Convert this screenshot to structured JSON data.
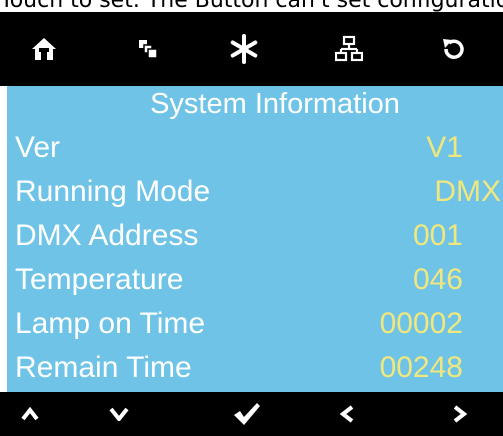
{
  "top_strip_text": "Touch to set. The Button can't set configuration, Long press to Unlock",
  "topbar": {
    "icons": [
      "home-icon",
      "copy-icon",
      "asterisk-icon",
      "network-icon",
      "refresh-icon"
    ]
  },
  "panel": {
    "title": "System Information",
    "rows": [
      {
        "label": "Ver",
        "value": "V1"
      },
      {
        "label": "Running Mode",
        "value": "DMX"
      },
      {
        "label": "DMX Address",
        "value": "001"
      },
      {
        "label": "Temperature",
        "value": "046"
      },
      {
        "label": "Lamp on Time",
        "value": "00002"
      },
      {
        "label": "Remain Time",
        "value": "00248"
      }
    ]
  },
  "bottombar": {
    "icons": [
      "up-icon",
      "down-icon",
      "check-icon",
      "left-icon",
      "right-icon"
    ]
  },
  "colors": {
    "background": "#ffffff",
    "bar": "#000000",
    "panel": "#6ec3e7",
    "label_text": "#ffffff",
    "value_text": "#f1e77f"
  }
}
